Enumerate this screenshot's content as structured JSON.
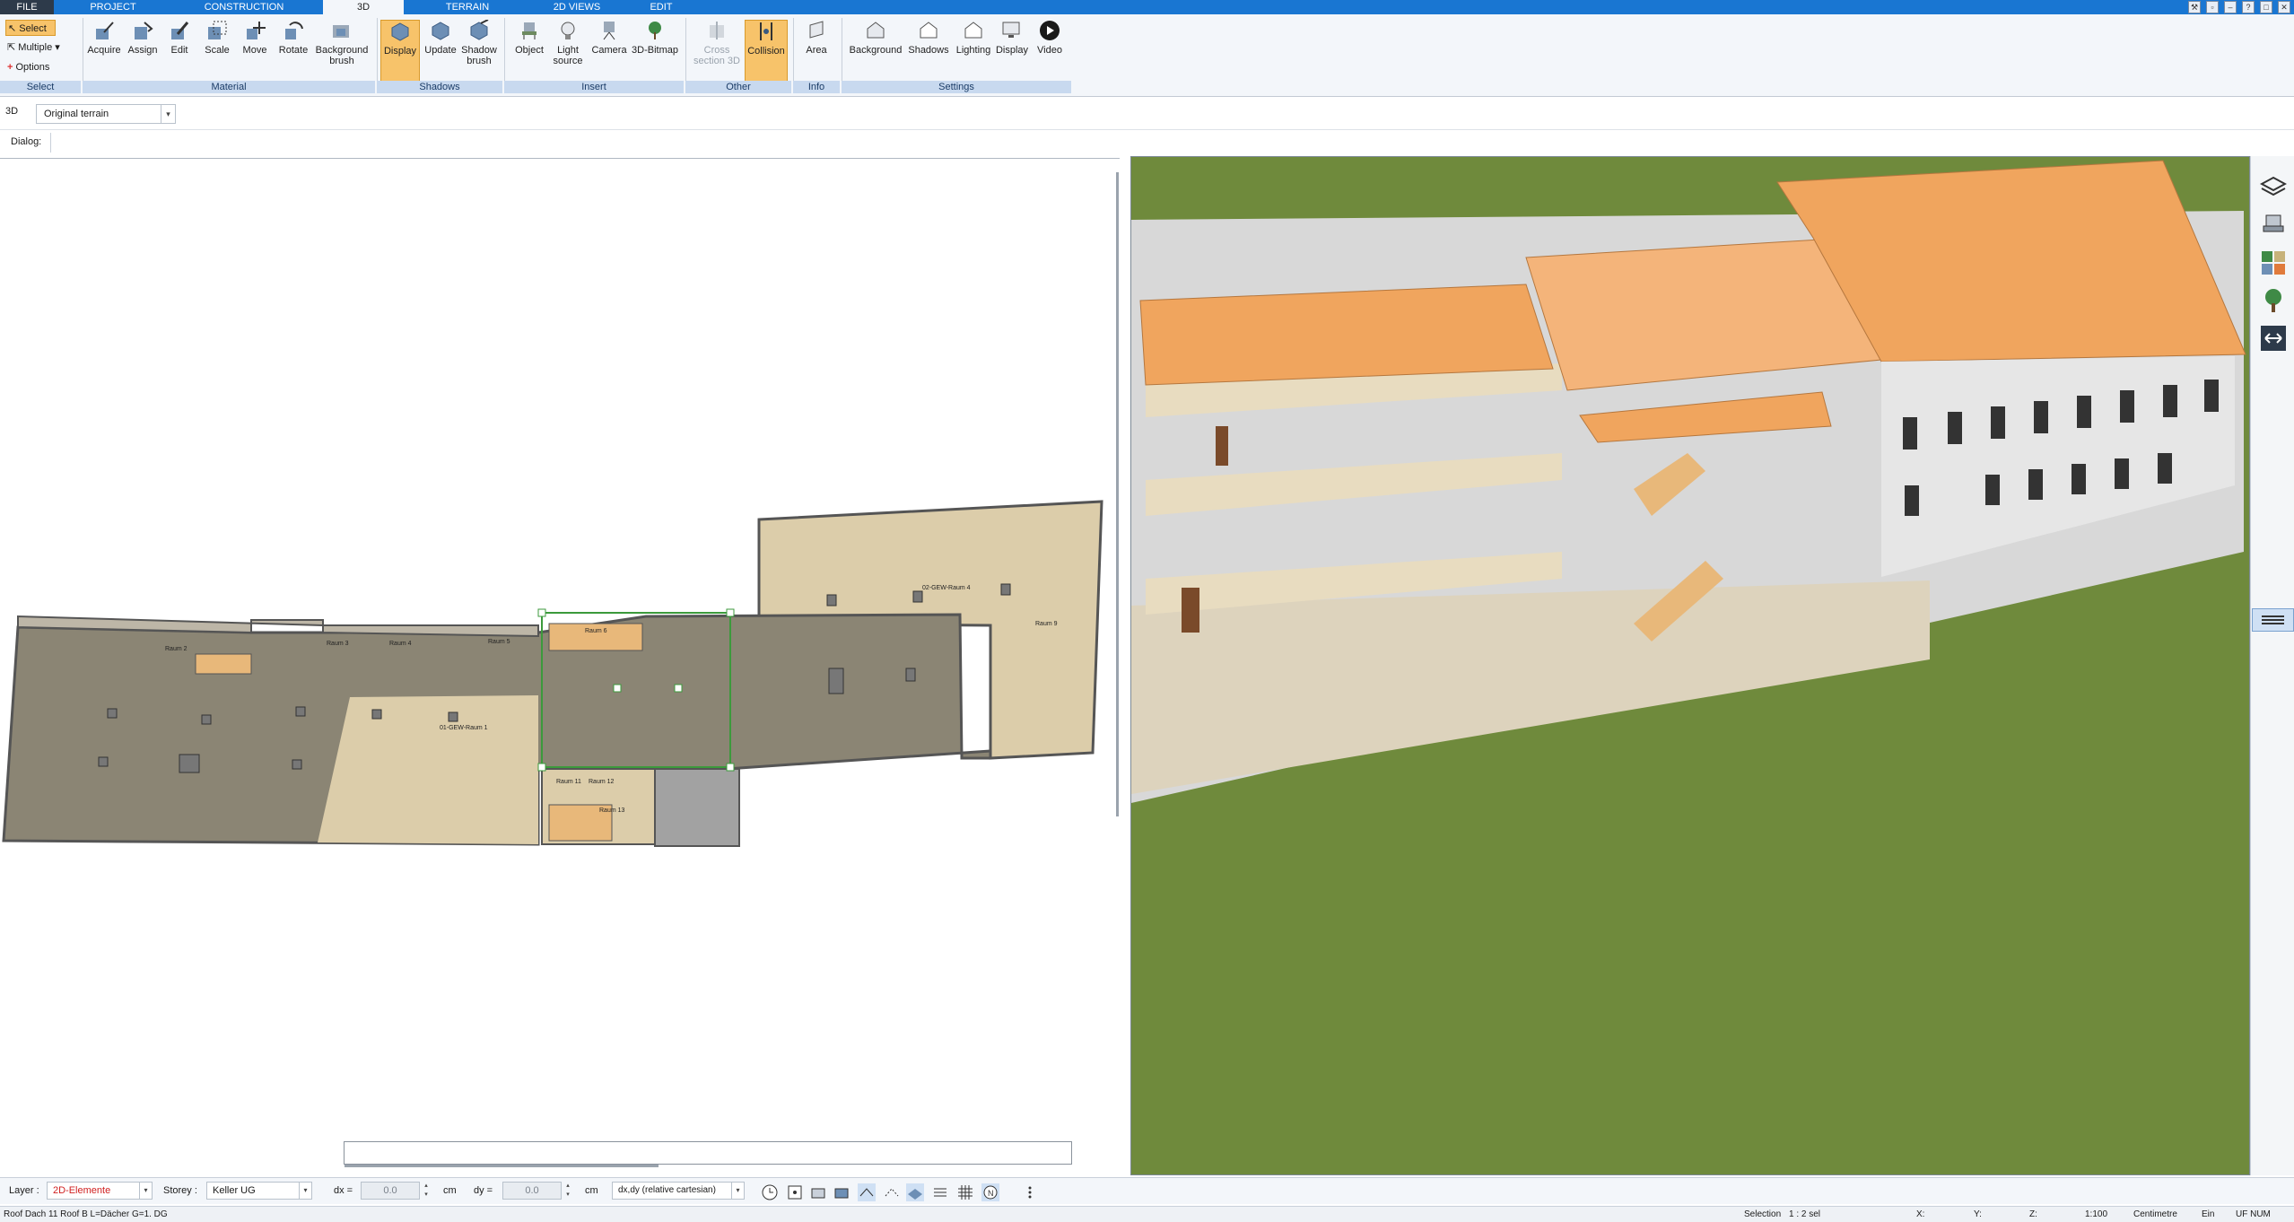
{
  "menu": {
    "tabs": [
      "FILE",
      "PROJECT",
      "CONSTRUCTION",
      "3D",
      "TERRAIN",
      "2D VIEWS",
      "EDIT"
    ],
    "active": "3D"
  },
  "ribbon": {
    "select": {
      "select_label": "Select",
      "multiple_label": "Multiple",
      "options_label": "Options",
      "group": "Select"
    },
    "material": {
      "buttons": [
        "Acquire",
        "Assign",
        "Edit",
        "Scale",
        "Move",
        "Rotate",
        "Background brush"
      ],
      "group": "Material"
    },
    "shadows": {
      "buttons": [
        "Display",
        "Update",
        "Shadow brush"
      ],
      "group": "Shadows"
    },
    "insert": {
      "buttons": [
        "Object",
        "Light source",
        "Camera",
        "3D-Bitmap"
      ],
      "group": "Insert"
    },
    "other": {
      "buttons": [
        "Cross section 3D",
        "Collision"
      ],
      "group": "Other"
    },
    "info": {
      "buttons": [
        "Area"
      ],
      "group": "Info"
    },
    "settings": {
      "buttons": [
        "Background",
        "Shadows",
        "Lighting",
        "Display",
        "Video"
      ],
      "group": "Settings"
    }
  },
  "toolbar": {
    "mode": "3D",
    "terrain": "Original terrain",
    "dialog_label": "Dialog:"
  },
  "plan": {
    "room_labels": [
      "Raum 2",
      "Raum 3",
      "Raum 4",
      "Raum 5",
      "01-GEW-Raum 1",
      "Raum 6",
      "02-GEW-Raum 4",
      "Raum 9",
      "Raum 11",
      "Raum 12",
      "Raum 13"
    ]
  },
  "side_icons": [
    "layers-icon",
    "furniture-icon",
    "materials-icon",
    "tree-icon",
    "arrows-icon"
  ],
  "status": {
    "layer_label": "Layer :",
    "layer_value": "2D-Elemente",
    "storey_label": "Storey :",
    "storey_value": "Keller UG",
    "dx_label": "dx =",
    "dx_value": "0.0",
    "dx_unit": "cm",
    "dy_label": "dy =",
    "dy_value": "0.0",
    "dy_unit": "cm",
    "coord_mode": "dx,dy (relative cartesian)"
  },
  "footer": {
    "element_info": "Roof Dach 11 Roof B L=Dächer G=1. DG",
    "selection_label": "Selection",
    "selection_value": "1 : 2 sel",
    "x_label": "X:",
    "y_label": "Y:",
    "z_label": "Z:",
    "scale": "1:100",
    "unit": "Centimetre",
    "ein": "Ein",
    "flags": "UF NUM"
  },
  "colors": {
    "accent": "#1976d2",
    "ribbon_bg": "#f3f6fa",
    "active_button": "#f7c36a",
    "group_bar": "#c8d9ef",
    "roof": "#f0a55e",
    "grass": "#6f8a3c",
    "floor_dark": "#8b8574",
    "floor_light": "#dccdaa"
  }
}
